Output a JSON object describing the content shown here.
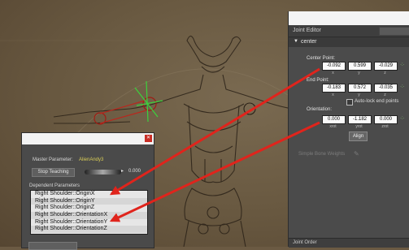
{
  "joint_editor": {
    "title": "Joint Editor",
    "section_label": "center",
    "center_point": {
      "label": "Center Point:",
      "x": "-0.092",
      "y": "0.599",
      "z": "-0.029"
    },
    "end_point": {
      "label": "End Point:",
      "x": "-0.183",
      "y": "0.572",
      "z": "-0.035"
    },
    "auto_lock_label": "Auto-lock end points",
    "orientation": {
      "label": "Orientation:",
      "xrot": "0.000",
      "yrot": "-1.182",
      "zrot": "0.000"
    },
    "axis_labels": {
      "x": "x",
      "y": "y",
      "z": "z",
      "xrot": "xrot",
      "yrot": "yrot",
      "zrot": "zrot"
    },
    "align_label": "Align",
    "weights_label": "Simple Bone Weights",
    "joint_order_label": "Joint Order"
  },
  "parameters_dialog": {
    "master_label": "Master Parameter:",
    "master_value": "AlienAndy3",
    "stop_teaching_label": "Stop Teaching",
    "dial_value": "0.000",
    "dependent_label": "Dependent Parameters",
    "items": [
      "Right Shoulder::OriginX",
      "Right Shoulder::OriginY",
      "Right Shoulder::OriginZ",
      "Right Shoulder::OrientationX",
      "Right Shoulder::OrientationY",
      "Right Shoulder::OrientationZ"
    ]
  },
  "colors": {
    "annotation_arrow": "#e0241c",
    "viewport_bg": "#6b5a43",
    "panel_bg": "#4b4b4b",
    "master_value": "#d8cc57"
  },
  "icons": {
    "section_toggle": "triangle-down-icon",
    "close": "close-icon",
    "weights": "paint-icon"
  }
}
